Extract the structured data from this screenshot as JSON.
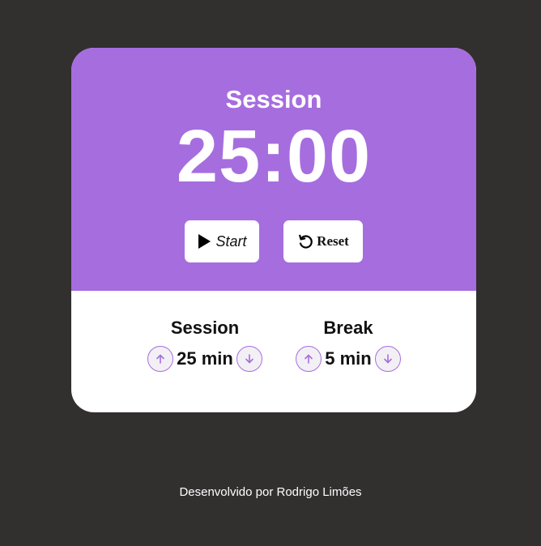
{
  "timer": {
    "label": "Session",
    "time": "25:00"
  },
  "controls": {
    "start_label": "Start",
    "reset_label": "Reset",
    "start_icon": "play-icon",
    "reset_icon": "reset-icon"
  },
  "settings": {
    "session": {
      "title": "Session",
      "value": "25 min",
      "increment_icon": "arrow-up-icon",
      "decrement_icon": "arrow-down-icon"
    },
    "break": {
      "title": "Break",
      "value": "5 min",
      "increment_icon": "arrow-up-icon",
      "decrement_icon": "arrow-down-icon"
    }
  },
  "footer": {
    "text": "Desenvolvido por Rodrigo Limões"
  },
  "colors": {
    "background": "#322f2f",
    "accent": "#a66ddf",
    "card": "#ffffff"
  }
}
